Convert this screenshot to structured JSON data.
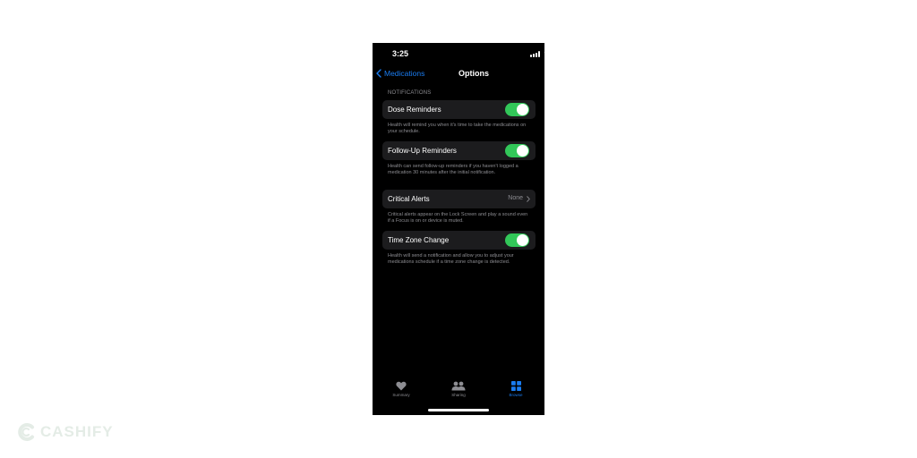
{
  "status": {
    "time": "3:25"
  },
  "nav": {
    "back_label": "Medications",
    "title": "Options"
  },
  "section_header": "NOTIFICATIONS",
  "settings": [
    {
      "label": "Dose Reminders",
      "control": "toggle",
      "on": true,
      "footer": "Health will remind you when it's time to take the medications on your schedule."
    },
    {
      "label": "Follow-Up Reminders",
      "control": "toggle",
      "on": true,
      "footer": "Health can send follow-up reminders if you haven't logged a medication 30 minutes after the initial notification."
    },
    {
      "label": "Critical Alerts",
      "control": "disclosure",
      "value": "None",
      "footer": "Critical alerts appear on the Lock Screen and play a sound even if a Focus is on or device is muted."
    },
    {
      "label": "Time Zone Change",
      "control": "toggle",
      "on": true,
      "footer": "Health will send a notification and allow you to adjust your medications schedule if a time zone change is detected."
    }
  ],
  "tabs": [
    {
      "label": "Summary",
      "icon": "heart-icon",
      "active": false
    },
    {
      "label": "Sharing",
      "icon": "people-icon",
      "active": false
    },
    {
      "label": "Browse",
      "icon": "grid-icon",
      "active": true
    }
  ],
  "watermark": {
    "text": "CASHIFY"
  },
  "colors": {
    "accent": "#1a7cf0",
    "toggle_on": "#32c759",
    "row_bg": "#1c1c1e",
    "secondary_text": "#8d8d92"
  }
}
